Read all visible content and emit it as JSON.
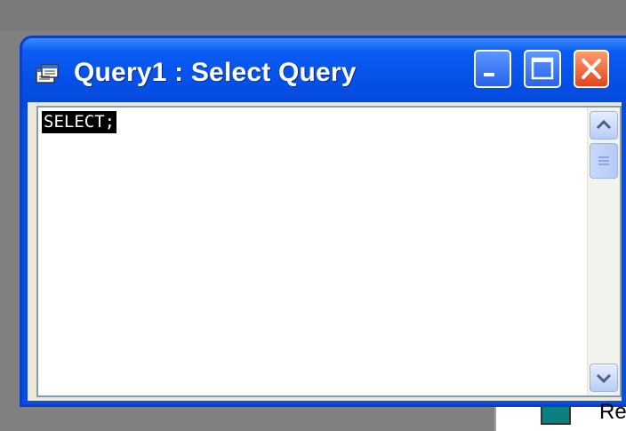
{
  "window": {
    "title": "Query1 : Select Query",
    "icon": "query-window-icon",
    "buttons": {
      "minimize": "minimize-icon",
      "maximize": "maximize-icon",
      "close": "close-icon"
    }
  },
  "editor": {
    "sql_text": "SELECT;",
    "selected": true
  },
  "background_app": {
    "item_label_fragment": "Re"
  },
  "colors": {
    "titlebar": "#0550e8",
    "close_button": "#e4441c",
    "selection_bg": "#000000",
    "selection_fg": "#ffffff"
  }
}
